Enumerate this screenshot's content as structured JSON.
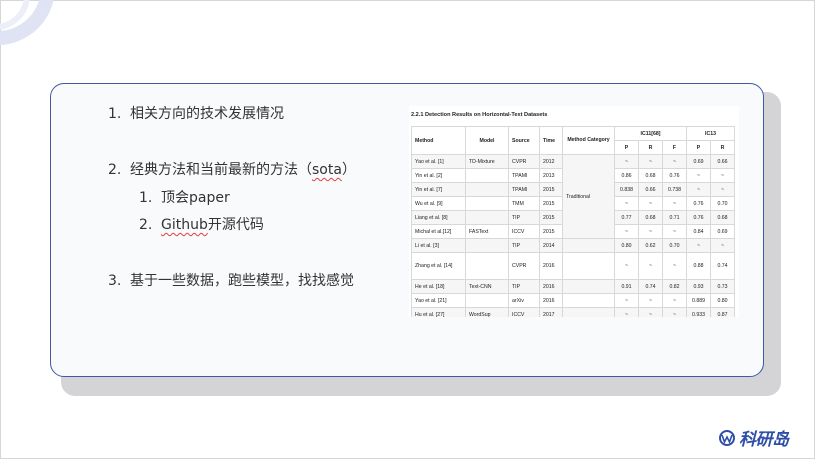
{
  "list": {
    "item1": {
      "num": "1.",
      "text": "相关方向的技术发展情况"
    },
    "item2": {
      "num": "2.",
      "text_before": "经典方法和当前最新的方法（",
      "text_underlined": "sota",
      "text_after": "）"
    },
    "sub1": {
      "num": "1.",
      "text": "顶会paper"
    },
    "sub2": {
      "num": "2.",
      "text_underlined": "Github",
      "text_after": "开源代码"
    },
    "item3": {
      "num": "3.",
      "text": "基于一些数据，跑些模型，找找感觉"
    }
  },
  "table": {
    "title": "2.2.1 Detection Results on Horizontal-Text Datasets",
    "headers": {
      "method": "Method",
      "model": "Model",
      "source": "Source",
      "time": "Time",
      "category": "Method Category",
      "ic11": "IC11[68]",
      "ic13": "IC13",
      "p": "P",
      "r": "R",
      "f": "F",
      "p2": "P",
      "r2": "R"
    },
    "category_label": "Traditional",
    "rows": [
      [
        "Yao et al. [1]",
        "TD-Mixture",
        "CVPR",
        "2012",
        "~",
        "~",
        "~",
        "0.69",
        "0.66"
      ],
      [
        "Yin et al. [2]",
        "",
        "TPAMI",
        "2013",
        "0.86",
        "0.68",
        "0.76",
        "~",
        "~"
      ],
      [
        "Yin et al. [7]",
        "",
        "TPAMI",
        "2015",
        "0.838",
        "0.66",
        "0.738",
        "~",
        "~"
      ],
      [
        "Wu et al. [9]",
        "",
        "TMM",
        "2015",
        "~",
        "~",
        "~",
        "0.76",
        "0.70"
      ],
      [
        "Liang et al. [8]",
        "",
        "TIP",
        "2015",
        "0.77",
        "0.68",
        "0.71",
        "0.76",
        "0.68"
      ],
      [
        "Michal et al.[12]",
        "FASText",
        "ICCV",
        "2015",
        "~",
        "~",
        "~",
        "0.84",
        "0.69"
      ],
      [
        "Li et al. [3]",
        "",
        "TIP",
        "2014",
        "0.80",
        "0.62",
        "0.70",
        "~",
        "~"
      ],
      [
        "Zhang et al. [14]",
        "",
        "CVPR",
        "2016",
        "~",
        "~",
        "~",
        "0.88",
        "0.74"
      ],
      [
        "He et al. [18]",
        "Text-CNN",
        "TIP",
        "2016",
        "0.91",
        "0.74",
        "0.82",
        "0.93",
        "0.73"
      ],
      [
        "Yao et al. [21]",
        "",
        "arXiv",
        "2016",
        "~",
        "~",
        "~",
        "0.889",
        "0.80"
      ],
      [
        "Hu et al. [27]",
        "WordSup",
        "ICCV",
        "2017",
        "~",
        "~",
        "~",
        "0.933",
        "0.87"
      ]
    ]
  },
  "logo": {
    "text": "科研岛"
  },
  "colors": {
    "border": "#3c5ba6",
    "accent": "#2f4ea8",
    "squiggle": "#e04040"
  }
}
